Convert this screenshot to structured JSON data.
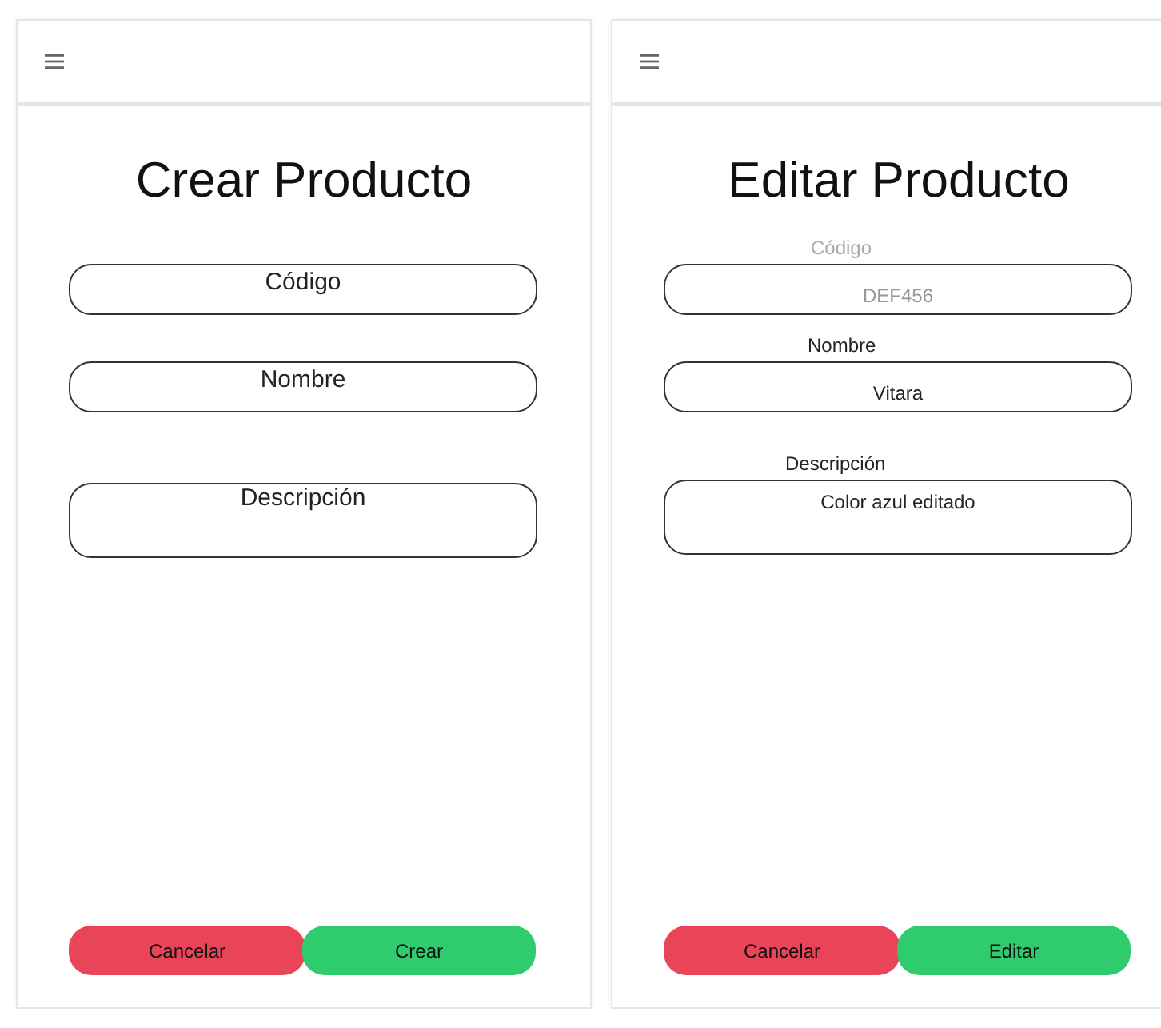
{
  "screens": [
    {
      "title": "Crear Producto",
      "fields": [
        {
          "kind": "line",
          "placeholder": "Código",
          "disabled": false
        },
        {
          "kind": "line",
          "placeholder": "Nombre",
          "disabled": false
        },
        {
          "kind": "multiline",
          "placeholder": "Descripción",
          "disabled": false
        }
      ],
      "buttons": [
        {
          "kind": "cancel",
          "label": "Cancelar"
        },
        {
          "kind": "confirm",
          "label": "Crear"
        }
      ]
    },
    {
      "title": "Editar Producto",
      "fields": [
        {
          "kind": "line",
          "label": "Código",
          "value": "DEF456",
          "disabled": true
        },
        {
          "kind": "line",
          "label": "Nombre",
          "value": "Vitara",
          "disabled": false
        },
        {
          "kind": "multiline",
          "label": "Descripción",
          "value": "Color azul editado",
          "disabled": false
        }
      ],
      "buttons": [
        {
          "kind": "cancel",
          "label": "Cancelar"
        },
        {
          "kind": "confirm",
          "label": "Editar"
        }
      ]
    }
  ]
}
